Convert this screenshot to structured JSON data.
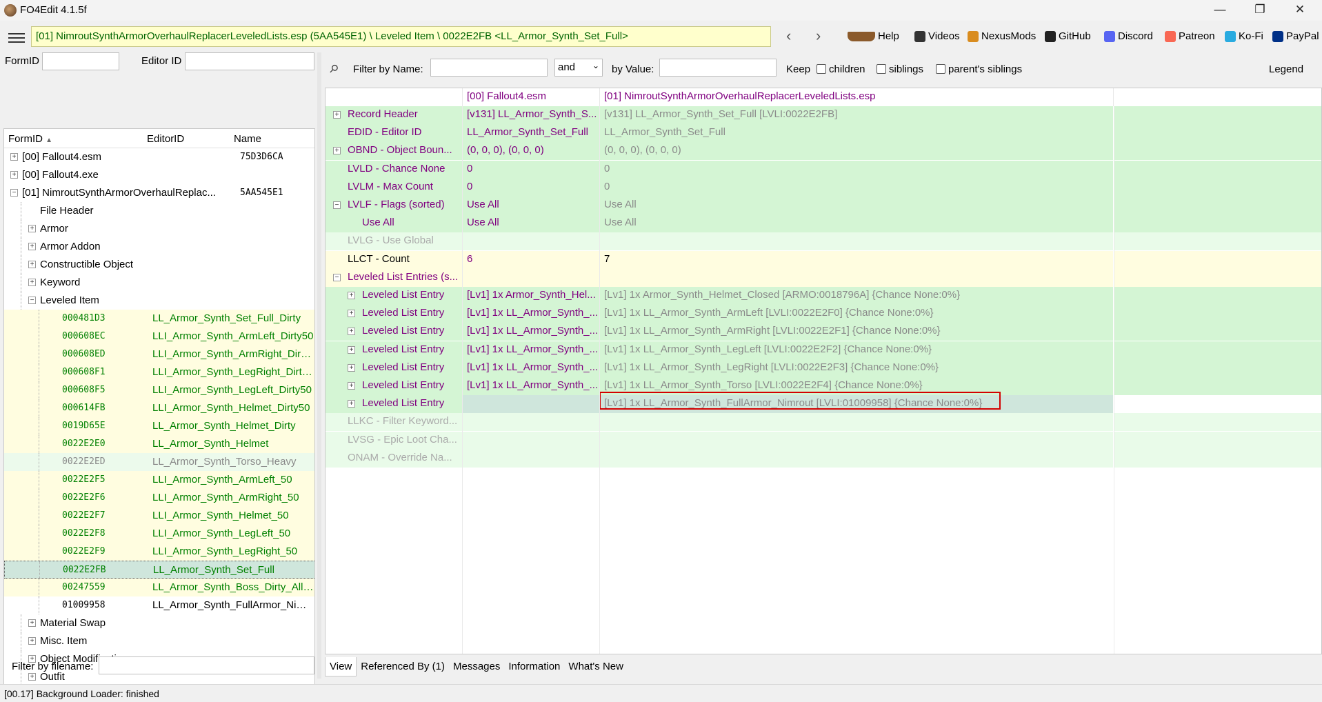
{
  "window": {
    "title": "FO4Edit 4.1.5f",
    "controls": [
      "—",
      "❐",
      "✕"
    ]
  },
  "toolbar": {
    "path": "[01] NimroutSynthArmorOverhaulReplacerLeveledLists.esp (5AA545E1) \\ Leveled Item \\ 0022E2FB <LL_Armor_Synth_Set_Full>",
    "back": "‹",
    "forward": "›",
    "links": [
      {
        "label": "Help",
        "icon": "book-icon",
        "color": "#8b5a2b"
      },
      {
        "label": "Videos",
        "icon": "video-icon",
        "color": "#333333"
      },
      {
        "label": "NexusMods",
        "icon": "nexus-icon",
        "color": "#d98c1f"
      },
      {
        "label": "GitHub",
        "icon": "github-icon",
        "color": "#222222"
      },
      {
        "label": "Discord",
        "icon": "discord-icon",
        "color": "#5865f2"
      },
      {
        "label": "Patreon",
        "icon": "patreon-icon",
        "color": "#f96854"
      },
      {
        "label": "Ko-Fi",
        "icon": "kofi-icon",
        "color": "#29abe0"
      },
      {
        "label": "PayPal",
        "icon": "paypal-icon",
        "color": "#003087"
      }
    ]
  },
  "left": {
    "formid_label": "FormID",
    "editorid_label": "Editor ID",
    "columns": {
      "formid": "FormID",
      "editorid": "EditorID",
      "name": "Name"
    },
    "tree": [
      {
        "indent": 0,
        "exp": "+",
        "formid": "[00] Fallout4.esm",
        "editorid": "",
        "name": "75D3D6CA",
        "style": "plain"
      },
      {
        "indent": 0,
        "exp": "+",
        "formid": "[00] Fallout4.exe",
        "editorid": "",
        "name": "",
        "style": "plain"
      },
      {
        "indent": 0,
        "exp": "-",
        "formid": "[01] NimroutSynthArmorOverhaulReplac...",
        "editorid": "",
        "name": "5AA545E1",
        "style": "plain"
      },
      {
        "indent": 1,
        "exp": "",
        "formid": "File Header",
        "editorid": "",
        "name": "",
        "style": "plain"
      },
      {
        "indent": 1,
        "exp": "+",
        "formid": "Armor",
        "editorid": "",
        "name": "",
        "style": "plain"
      },
      {
        "indent": 1,
        "exp": "+",
        "formid": "Armor Addon",
        "editorid": "",
        "name": "",
        "style": "plain"
      },
      {
        "indent": 1,
        "exp": "+",
        "formid": "Constructible Object",
        "editorid": "",
        "name": "",
        "style": "plain"
      },
      {
        "indent": 1,
        "exp": "+",
        "formid": "Keyword",
        "editorid": "",
        "name": "",
        "style": "plain"
      },
      {
        "indent": 1,
        "exp": "-",
        "formid": "Leveled Item",
        "editorid": "",
        "name": "",
        "style": "plain"
      },
      {
        "indent": 2,
        "exp": "",
        "formid": "000481D3",
        "editorid": "LL_Armor_Synth_Set_Full_Dirty",
        "name": "",
        "style": "yellow"
      },
      {
        "indent": 2,
        "exp": "",
        "formid": "000608EC",
        "editorid": "LLI_Armor_Synth_ArmLeft_Dirty50",
        "name": "",
        "style": "yellow"
      },
      {
        "indent": 2,
        "exp": "",
        "formid": "000608ED",
        "editorid": "LLI_Armor_Synth_ArmRight_Dirty...",
        "name": "",
        "style": "yellow"
      },
      {
        "indent": 2,
        "exp": "",
        "formid": "000608F1",
        "editorid": "LLI_Armor_Synth_LegRight_Dirty50",
        "name": "",
        "style": "yellow"
      },
      {
        "indent": 2,
        "exp": "",
        "formid": "000608F5",
        "editorid": "LLI_Armor_Synth_LegLeft_Dirty50",
        "name": "",
        "style": "yellow"
      },
      {
        "indent": 2,
        "exp": "",
        "formid": "000614FB",
        "editorid": "LLI_Armor_Synth_Helmet_Dirty50",
        "name": "",
        "style": "yellow"
      },
      {
        "indent": 2,
        "exp": "",
        "formid": "0019D65E",
        "editorid": "LL_Armor_Synth_Helmet_Dirty",
        "name": "",
        "style": "yellow"
      },
      {
        "indent": 2,
        "exp": "",
        "formid": "0022E2E0",
        "editorid": "LL_Armor_Synth_Helmet",
        "name": "",
        "style": "yellow"
      },
      {
        "indent": 2,
        "exp": "",
        "formid": "0022E2ED",
        "editorid": "LL_Armor_Synth_Torso_Heavy",
        "name": "",
        "style": "green"
      },
      {
        "indent": 2,
        "exp": "",
        "formid": "0022E2F5",
        "editorid": "LLI_Armor_Synth_ArmLeft_50",
        "name": "",
        "style": "yellow"
      },
      {
        "indent": 2,
        "exp": "",
        "formid": "0022E2F6",
        "editorid": "LLI_Armor_Synth_ArmRight_50",
        "name": "",
        "style": "yellow"
      },
      {
        "indent": 2,
        "exp": "",
        "formid": "0022E2F7",
        "editorid": "LLI_Armor_Synth_Helmet_50",
        "name": "",
        "style": "yellow"
      },
      {
        "indent": 2,
        "exp": "",
        "formid": "0022E2F8",
        "editorid": "LLI_Armor_Synth_LegLeft_50",
        "name": "",
        "style": "yellow"
      },
      {
        "indent": 2,
        "exp": "",
        "formid": "0022E2F9",
        "editorid": "LLI_Armor_Synth_LegRight_50",
        "name": "",
        "style": "yellow"
      },
      {
        "indent": 2,
        "exp": "",
        "formid": "0022E2FB",
        "editorid": "LL_Armor_Synth_Set_Full",
        "name": "",
        "style": "sel"
      },
      {
        "indent": 2,
        "exp": "",
        "formid": "00247559",
        "editorid": "LL_Armor_Synth_Boss_Dirty_All50",
        "name": "",
        "style": "yellow"
      },
      {
        "indent": 2,
        "exp": "",
        "formid": "01009958",
        "editorid": "LL_Armor_Synth_FullArmor_Nimr...",
        "name": "",
        "style": "plain"
      },
      {
        "indent": 1,
        "exp": "+",
        "formid": "Material Swap",
        "editorid": "",
        "name": "",
        "style": "plain"
      },
      {
        "indent": 1,
        "exp": "+",
        "formid": "Misc. Item",
        "editorid": "",
        "name": "",
        "style": "plain"
      },
      {
        "indent": 1,
        "exp": "+",
        "formid": "Object Modification",
        "editorid": "",
        "name": "",
        "style": "plain"
      },
      {
        "indent": 1,
        "exp": "+",
        "formid": "Outfit",
        "editorid": "",
        "name": "",
        "style": "plain"
      }
    ],
    "filter_filename_label": "Filter by filename:"
  },
  "right": {
    "filter": {
      "by_name_label": "Filter by Name:",
      "operator": "and",
      "by_value_label": "by Value:",
      "keep_label": "Keep",
      "checks": [
        "children",
        "siblings",
        "parent's siblings"
      ],
      "legend": "Legend"
    },
    "columns": [
      "",
      "[00] Fallout4.esm",
      "[01] NimroutSynthArmorOverhaulReplacerLeveledLists.esp"
    ],
    "rows": [
      {
        "indent": 0,
        "exp": "+",
        "name": "Record Header",
        "v0": "[v131] LL_Armor_Synth_S...",
        "v1": "[v131] LL_Armor_Synth_Set_Full [LVLI:0022E2FB]",
        "bg": "green",
        "nameColor": "purple",
        "v0Color": "purple",
        "v1Color": "grey"
      },
      {
        "indent": 0,
        "exp": "",
        "name": "EDID - Editor ID",
        "v0": "LL_Armor_Synth_Set_Full",
        "v1": "LL_Armor_Synth_Set_Full",
        "bg": "green",
        "nameColor": "purple",
        "v0Color": "purple",
        "v1Color": "grey"
      },
      {
        "indent": 0,
        "exp": "+",
        "name": "OBND - Object Boun...",
        "v0": "(0, 0, 0), (0, 0, 0)",
        "v1": "(0, 0, 0), (0, 0, 0)",
        "bg": "green",
        "nameColor": "purple",
        "v0Color": "purple",
        "v1Color": "grey"
      },
      {
        "indent": 0,
        "exp": "",
        "name": "LVLD - Chance None",
        "v0": "0",
        "v1": "0",
        "bg": "green",
        "nameColor": "purple",
        "v0Color": "purple",
        "v1Color": "grey"
      },
      {
        "indent": 0,
        "exp": "",
        "name": "LVLM - Max Count",
        "v0": "0",
        "v1": "0",
        "bg": "green",
        "nameColor": "purple",
        "v0Color": "purple",
        "v1Color": "grey"
      },
      {
        "indent": 0,
        "exp": "-",
        "name": "LVLF - Flags (sorted)",
        "v0": "Use All",
        "v1": "Use All",
        "bg": "green",
        "nameColor": "purple",
        "v0Color": "purple",
        "v1Color": "grey"
      },
      {
        "indent": 1,
        "exp": "",
        "name": "Use All",
        "v0": "Use All",
        "v1": "Use All",
        "bg": "green",
        "nameColor": "purple",
        "v0Color": "purple",
        "v1Color": "grey"
      },
      {
        "indent": 0,
        "exp": "",
        "name": "LVLG - Use Global",
        "v0": "",
        "v1": "",
        "bg": "lgreen",
        "nameColor": "lgrey",
        "v0Color": "lgrey",
        "v1Color": "lgrey"
      },
      {
        "indent": 0,
        "exp": "",
        "name": "LLCT - Count",
        "v0": "6",
        "v1": "7",
        "bg": "yellow",
        "nameColor": "black",
        "v0Color": "purple",
        "v1Color": "black"
      },
      {
        "indent": 0,
        "exp": "-",
        "name": "Leveled List Entries (s...",
        "v0": "",
        "v1": "",
        "bg": "yellow",
        "nameColor": "purple",
        "v0Color": "purple",
        "v1Color": "grey"
      },
      {
        "indent": 1,
        "exp": "+",
        "name": "Leveled List Entry",
        "v0": "[Lv1] 1x Armor_Synth_Hel...",
        "v1": "[Lv1] 1x Armor_Synth_Helmet_Closed [ARMO:0018796A] {Chance None:0%}",
        "bg": "green",
        "nameColor": "purple",
        "v0Color": "purple",
        "v1Color": "grey"
      },
      {
        "indent": 1,
        "exp": "+",
        "name": "Leveled List Entry",
        "v0": "[Lv1] 1x LL_Armor_Synth_...",
        "v1": "[Lv1] 1x LL_Armor_Synth_ArmLeft [LVLI:0022E2F0] {Chance None:0%}",
        "bg": "green",
        "nameColor": "purple",
        "v0Color": "purple",
        "v1Color": "grey"
      },
      {
        "indent": 1,
        "exp": "+",
        "name": "Leveled List Entry",
        "v0": "[Lv1] 1x LL_Armor_Synth_...",
        "v1": "[Lv1] 1x LL_Armor_Synth_ArmRight [LVLI:0022E2F1] {Chance None:0%}",
        "bg": "green",
        "nameColor": "purple",
        "v0Color": "purple",
        "v1Color": "grey"
      },
      {
        "indent": 1,
        "exp": "+",
        "name": "Leveled List Entry",
        "v0": "[Lv1] 1x LL_Armor_Synth_...",
        "v1": "[Lv1] 1x LL_Armor_Synth_LegLeft [LVLI:0022E2F2] {Chance None:0%}",
        "bg": "green",
        "nameColor": "purple",
        "v0Color": "purple",
        "v1Color": "grey"
      },
      {
        "indent": 1,
        "exp": "+",
        "name": "Leveled List Entry",
        "v0": "[Lv1] 1x LL_Armor_Synth_...",
        "v1": "[Lv1] 1x LL_Armor_Synth_LegRight [LVLI:0022E2F3] {Chance None:0%}",
        "bg": "green",
        "nameColor": "purple",
        "v0Color": "purple",
        "v1Color": "grey"
      },
      {
        "indent": 1,
        "exp": "+",
        "name": "Leveled List Entry",
        "v0": "[Lv1] 1x LL_Armor_Synth_...",
        "v1": "[Lv1] 1x LL_Armor_Synth_Torso [LVLI:0022E2F4] {Chance None:0%}",
        "bg": "green",
        "nameColor": "purple",
        "v0Color": "purple",
        "v1Color": "grey"
      },
      {
        "indent": 1,
        "exp": "+",
        "name": "Leveled List Entry",
        "v0": "",
        "v1": "[Lv1] 1x LL_Armor_Synth_FullArmor_Nimrout [LVLI:01009958] {Chance None:0%}",
        "bg": "sel",
        "nameColor": "purple",
        "v0Color": "purple",
        "v1Color": "grey"
      },
      {
        "indent": 0,
        "exp": "",
        "name": "LLKC - Filter Keyword...",
        "v0": "",
        "v1": "",
        "bg": "lgreen",
        "nameColor": "lgrey",
        "v0Color": "lgrey",
        "v1Color": "lgrey"
      },
      {
        "indent": 0,
        "exp": "",
        "name": "LVSG - Epic Loot Cha...",
        "v0": "",
        "v1": "",
        "bg": "lgreen",
        "nameColor": "lgrey",
        "v0Color": "lgrey",
        "v1Color": "lgrey"
      },
      {
        "indent": 0,
        "exp": "",
        "name": "ONAM - Override Na...",
        "v0": "",
        "v1": "",
        "bg": "lgreen",
        "nameColor": "lgrey",
        "v0Color": "lgrey",
        "v1Color": "lgrey"
      }
    ],
    "tabs": [
      "View",
      "Referenced By (1)",
      "Messages",
      "Information",
      "What's New"
    ]
  },
  "status": "[00.17] Background Loader: finished",
  "colors": {
    "path_bg": "#ffffcc",
    "green_row": "#d4f5d4",
    "yellow_row": "#fffde0",
    "highlight": "#d40000"
  }
}
